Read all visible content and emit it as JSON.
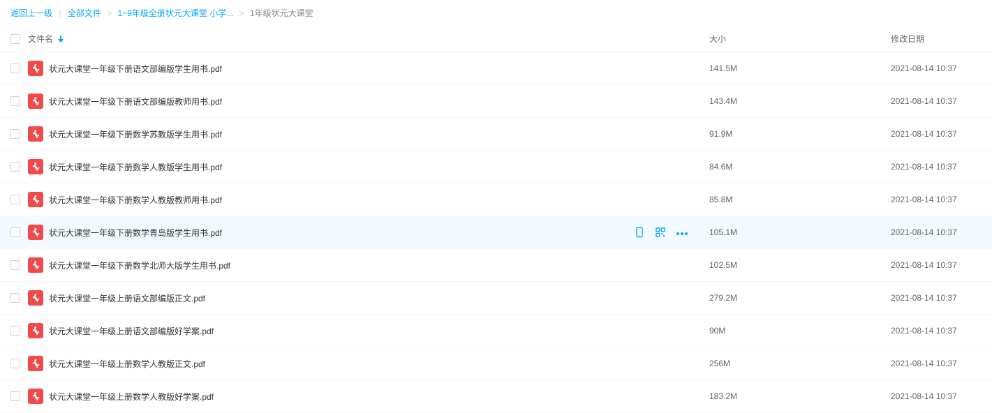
{
  "breadcrumb": {
    "back": "返回上一级",
    "root": "全部文件",
    "path1": "1~9年级全册状元大课堂 小学...",
    "current": "1年级状元大课堂"
  },
  "headers": {
    "name": "文件名",
    "size": "大小",
    "date": "修改日期"
  },
  "hover_index": 5,
  "files": [
    {
      "name": "状元大课堂一年级下册语文部编版学生用书.pdf",
      "size": "141.5M",
      "date": "2021-08-14 10:37"
    },
    {
      "name": "状元大课堂一年级下册语文部编版教师用书.pdf",
      "size": "143.4M",
      "date": "2021-08-14 10:37"
    },
    {
      "name": "状元大课堂一年级下册数学苏教版学生用书.pdf",
      "size": "91.9M",
      "date": "2021-08-14 10:37"
    },
    {
      "name": "状元大课堂一年级下册数学人教版学生用书.pdf",
      "size": "84.6M",
      "date": "2021-08-14 10:37"
    },
    {
      "name": "状元大课堂一年级下册数学人教版教师用书.pdf",
      "size": "85.8M",
      "date": "2021-08-14 10:37"
    },
    {
      "name": "状元大课堂一年级下册数学青岛版学生用书.pdf",
      "size": "105.1M",
      "date": "2021-08-14 10:37"
    },
    {
      "name": "状元大课堂一年级下册数学北师大版学生用书.pdf",
      "size": "102.5M",
      "date": "2021-08-14 10:37"
    },
    {
      "name": "状元大课堂一年级上册语文部编版正文.pdf",
      "size": "279.2M",
      "date": "2021-08-14 10:37"
    },
    {
      "name": "状元大课堂一年级上册语文部编版好学案.pdf",
      "size": "90M",
      "date": "2021-08-14 10:37"
    },
    {
      "name": "状元大课堂一年级上册数学人教版正文.pdf",
      "size": "256M",
      "date": "2021-08-14 10:37"
    },
    {
      "name": "状元大课堂一年级上册数学人教版好学案.pdf",
      "size": "183.2M",
      "date": "2021-08-14 10:37"
    }
  ]
}
